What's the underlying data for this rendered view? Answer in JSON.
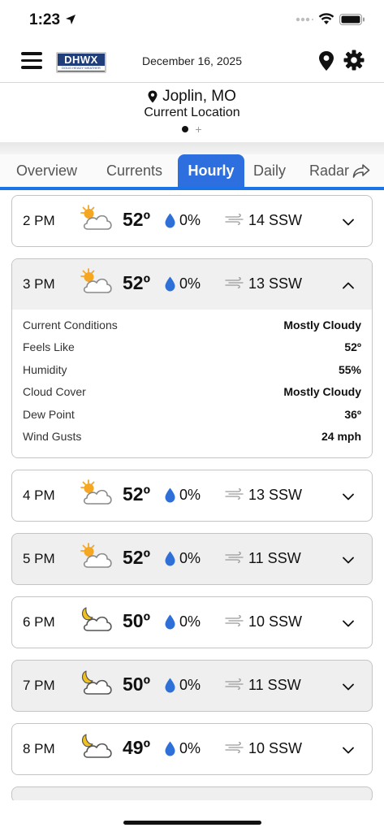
{
  "status_bar": {
    "time": "1:23"
  },
  "header": {
    "logo_text": "DHWX",
    "logo_subtext": "DOUG HEADY WEATHER",
    "date": "December 16, 2025"
  },
  "location": {
    "city": "Joplin, MO",
    "subtitle": "Current Location",
    "add_symbol": "+"
  },
  "tabs": [
    {
      "label": "Overview"
    },
    {
      "label": "Currents"
    },
    {
      "label": "Hourly"
    },
    {
      "label": "Daily"
    },
    {
      "label": "Radar"
    }
  ],
  "active_tab": "Hourly",
  "colors": {
    "accent": "#2d6fde",
    "precip_drop": "#2f6fd8",
    "sun": "#f5a623"
  },
  "hourly": [
    {
      "hour": "2 PM",
      "icon": "partly-sunny-icon",
      "temp": "52º",
      "precip": "0%",
      "wind": "14 SSW",
      "expanded": false
    },
    {
      "hour": "3 PM",
      "icon": "partly-sunny-icon",
      "temp": "52º",
      "precip": "0%",
      "wind": "13 SSW",
      "expanded": true,
      "details": [
        {
          "label": "Current Conditions",
          "value": "Mostly Cloudy"
        },
        {
          "label": "Feels Like",
          "value": "52º"
        },
        {
          "label": "Humidity",
          "value": "55%"
        },
        {
          "label": "Cloud Cover",
          "value": "Mostly Cloudy"
        },
        {
          "label": "Dew Point",
          "value": "36º"
        },
        {
          "label": "Wind Gusts",
          "value": "24 mph"
        }
      ]
    },
    {
      "hour": "4 PM",
      "icon": "partly-sunny-icon",
      "temp": "52º",
      "precip": "0%",
      "wind": "13 SSW",
      "expanded": false
    },
    {
      "hour": "5 PM",
      "icon": "partly-sunny-icon",
      "temp": "52º",
      "precip": "0%",
      "wind": "11 SSW",
      "expanded": false
    },
    {
      "hour": "6 PM",
      "icon": "partly-cloudy-night-icon",
      "temp": "50º",
      "precip": "0%",
      "wind": "10 SSW",
      "expanded": false
    },
    {
      "hour": "7 PM",
      "icon": "partly-cloudy-night-icon",
      "temp": "50º",
      "precip": "0%",
      "wind": "11 SSW",
      "expanded": false
    },
    {
      "hour": "8 PM",
      "icon": "partly-cloudy-night-icon",
      "temp": "49º",
      "precip": "0%",
      "wind": "10 SSW",
      "expanded": false
    }
  ]
}
